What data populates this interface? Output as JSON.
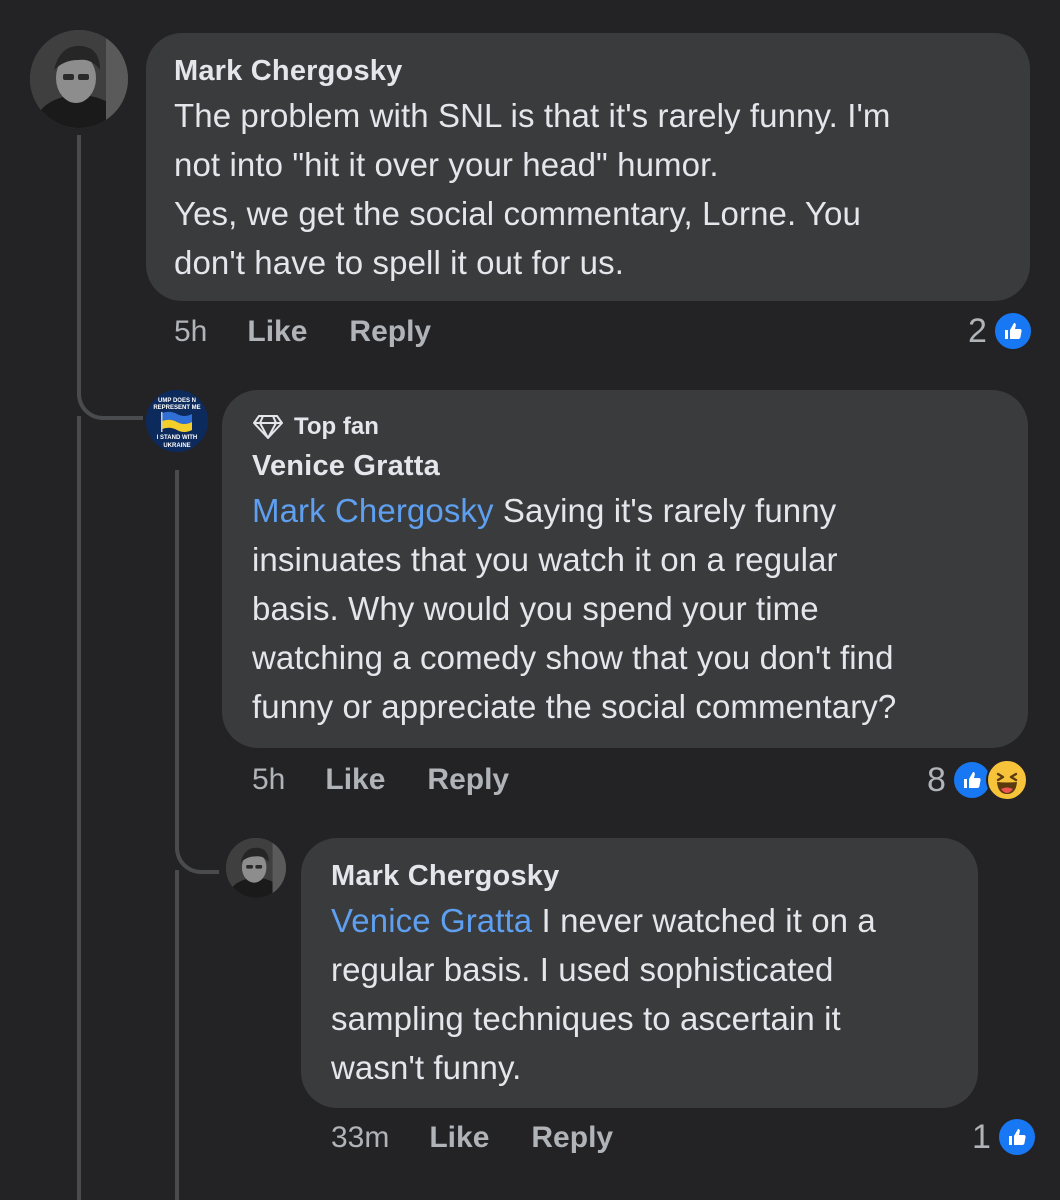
{
  "comments": [
    {
      "author": "Mark Chergosky",
      "lines": [
        "The problem with SNL is that it's rarely funny. I'm",
        "not into \"hit it over your head\" humor.",
        "Yes, we get the social commentary, Lorne. You",
        "don't  have to spell it out for us."
      ],
      "time": "5h",
      "like_label": "Like",
      "reply_label": "Reply",
      "reaction_count": "2",
      "reactions": [
        "like"
      ]
    },
    {
      "badge": "Top fan",
      "author": "Venice Gratta",
      "avatar_text": [
        "UMP DOES N",
        "REPRESENT ME",
        "I STAND WITH",
        "UKRAINE"
      ],
      "mention": "Mark Chergosky",
      "lines": [
        "Saying it's rarely funny",
        "insinuates that you watch it on a regular",
        "basis. Why would you spend your time",
        "watching a comedy show that you don't find",
        "funny or appreciate the social commentary?"
      ],
      "time": "5h",
      "like_label": "Like",
      "reply_label": "Reply",
      "reaction_count": "8",
      "reactions": [
        "like",
        "haha"
      ]
    },
    {
      "author": "Mark Chergosky",
      "mention": "Venice Gratta",
      "lines": [
        "I never watched it on a",
        "regular basis. I used sophisticated",
        "sampling techniques to ascertain it",
        "wasn't funny."
      ],
      "time": "33m",
      "like_label": "Like",
      "reply_label": "Reply",
      "reaction_count": "1",
      "reactions": [
        "like"
      ]
    }
  ],
  "icons": {
    "top_fan": "diamond-icon",
    "like": "thumbs-up-icon",
    "haha": "laughing-face-icon"
  },
  "colors": {
    "background": "#232325",
    "bubble": "#3a3b3d",
    "mention": "#5e9ff0",
    "like_blue": "#1877f2",
    "haha_yellow": "#f7c33a",
    "muted_text": "#b0b3b8"
  }
}
